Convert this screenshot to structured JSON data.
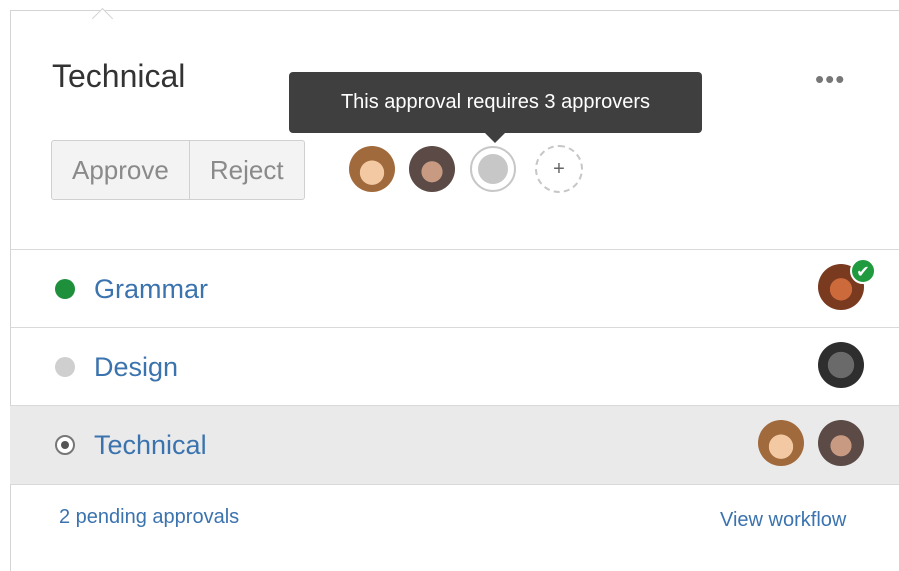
{
  "card": {
    "title": "Technical",
    "more_label": "•••"
  },
  "actions": {
    "approve_label": "Approve",
    "reject_label": "Reject",
    "add_label": "+"
  },
  "tooltip": {
    "text": "This approval requires 3 approvers"
  },
  "steps": [
    {
      "label": "Grammar",
      "status": "approved",
      "status_color": "#1e8f3a"
    },
    {
      "label": "Design",
      "status": "pending",
      "status_color": "#cfcfcf"
    },
    {
      "label": "Technical",
      "status": "current",
      "status_color": "#555555"
    }
  ],
  "check_mark": "✔",
  "footer": {
    "pending_text": "2 pending approvals",
    "workflow_link": "View workflow"
  },
  "colors": {
    "link": "#3b73af",
    "tooltip_bg": "#3f3f3f",
    "approved": "#1e8f3a"
  }
}
